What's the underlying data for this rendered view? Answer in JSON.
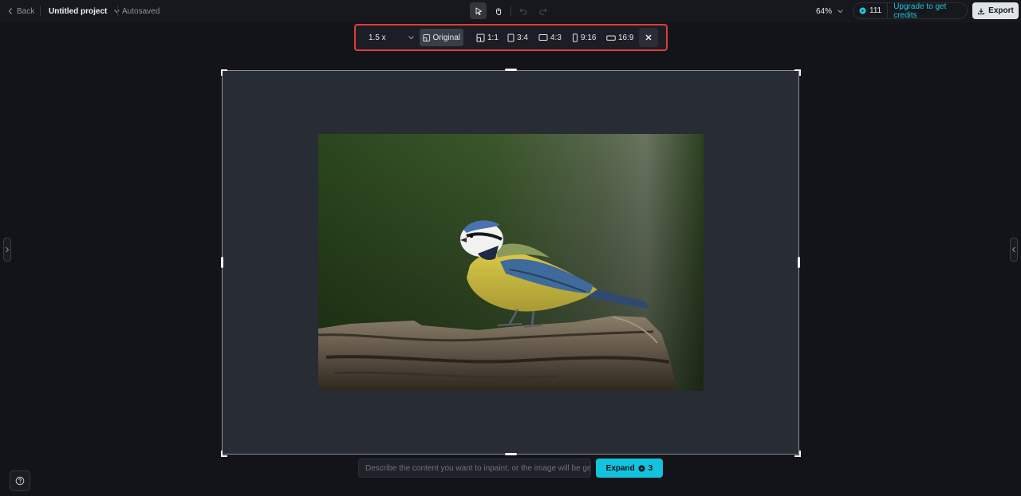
{
  "header": {
    "back_label": "Back",
    "project_title": "Untitled project",
    "autosave_status": "Autosaved",
    "zoom_level": "64%",
    "credits_count": "111",
    "upgrade_label": "Upgrade to get credits",
    "export_label": "Export"
  },
  "ratio_toolbar": {
    "scale_value": "1.5 x",
    "options": [
      {
        "label": "Original",
        "icon": "original-ratio-icon",
        "selected": true
      },
      {
        "label": "1:1",
        "icon": "square-ratio-icon"
      },
      {
        "label": "3:4",
        "icon": "portrait-ratio-icon"
      },
      {
        "label": "4:3",
        "icon": "landscape-ratio-icon"
      },
      {
        "label": "9:16",
        "icon": "tall-ratio-icon"
      },
      {
        "label": "16:9",
        "icon": "wide-ratio-icon"
      }
    ]
  },
  "prompt": {
    "placeholder": "Describe the content you want to inpaint, or the image will be gene...",
    "expand_label": "Expand",
    "expand_cost": "3"
  },
  "colors": {
    "accent": "#12c3dd",
    "highlight_border": "#e03b3b",
    "background": "#121419"
  }
}
